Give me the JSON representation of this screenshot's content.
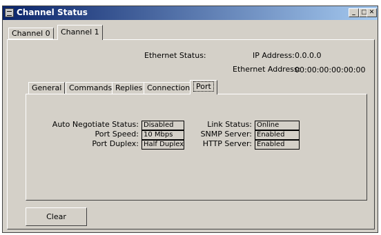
{
  "window": {
    "title": "Channel Status",
    "minimize": "_",
    "maximize": "□",
    "close": "✕"
  },
  "channel_tabs": [
    "Channel 0",
    "Channel 1"
  ],
  "active_channel_tab": "Channel 1",
  "ethernet": {
    "status_label": "Ethernet Status:",
    "ip_label": "IP Address:",
    "ip_value": "0.0.0.0",
    "mac_label": "Ethernet Address:",
    "mac_value": "00:00:00:00:00:00"
  },
  "sub_tabs": [
    "General",
    "Commands",
    "Replies",
    "Connections",
    "Port"
  ],
  "active_sub_tab": "Port",
  "port": {
    "auto_negotiate_label": "Auto Negotiate Status:",
    "auto_negotiate_value": "Disabled",
    "port_speed_label": "Port Speed:",
    "port_speed_value": "10 Mbps",
    "port_duplex_label": "Port Duplex:",
    "port_duplex_value": "Half Duplex",
    "link_status_label": "Link Status:",
    "link_status_value": "Online",
    "snmp_label": "SNMP Server:",
    "snmp_value": "Enabled",
    "http_label": "HTTP Server:",
    "http_value": "Enabled"
  },
  "clear_button": "Clear"
}
